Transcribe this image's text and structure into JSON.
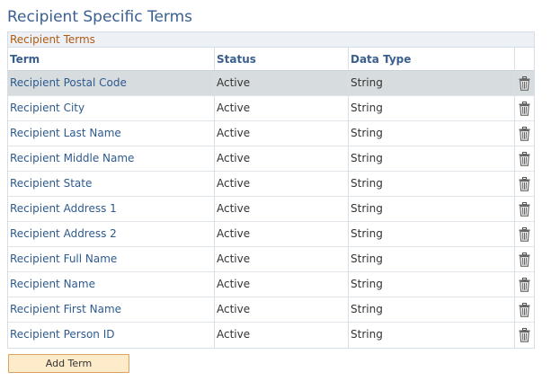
{
  "page": {
    "title": "Recipient Specific Terms"
  },
  "grid": {
    "caption": "Recipient Terms",
    "columns": {
      "term": "Term",
      "status": "Status",
      "data_type": "Data Type"
    },
    "rows": [
      {
        "term": "Recipient Postal Code",
        "status": "Active",
        "data_type": "String",
        "selected": true
      },
      {
        "term": "Recipient City",
        "status": "Active",
        "data_type": "String"
      },
      {
        "term": "Recipient Last Name",
        "status": "Active",
        "data_type": "String"
      },
      {
        "term": "Recipient Middle Name",
        "status": "Active",
        "data_type": "String"
      },
      {
        "term": "Recipient State",
        "status": "Active",
        "data_type": "String"
      },
      {
        "term": "Recipient Address 1",
        "status": "Active",
        "data_type": "String"
      },
      {
        "term": "Recipient Address 2",
        "status": "Active",
        "data_type": "String"
      },
      {
        "term": "Recipient Full Name",
        "status": "Active",
        "data_type": "String"
      },
      {
        "term": "Recipient Name",
        "status": "Active",
        "data_type": "String"
      },
      {
        "term": "Recipient First Name",
        "status": "Active",
        "data_type": "String"
      },
      {
        "term": "Recipient Person ID",
        "status": "Active",
        "data_type": "String"
      }
    ],
    "row_icon": "trash-icon"
  },
  "actions": {
    "add_term_label": "Add Term"
  },
  "colors": {
    "title": "#3a5f8f",
    "caption": "#b05a13",
    "link": "#2e5a8e",
    "selected_row": "#d7dcdf",
    "button_bg": "#fdebc9",
    "button_border": "#d9a460"
  }
}
